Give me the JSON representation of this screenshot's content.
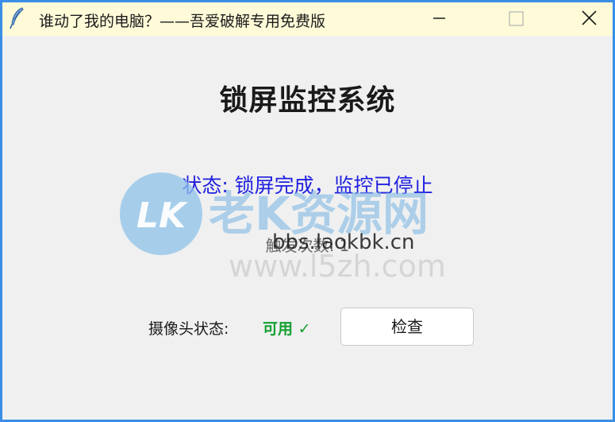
{
  "window": {
    "title": "谁动了我的电脑？——吾爱破解专用免费版"
  },
  "main": {
    "title": "锁屏监控系统",
    "status": "状态: 锁屏完成，监控已停止",
    "trigger": "触发次数: 1",
    "camera_label": "摄像头状态:",
    "camera_value": "可用 ✓",
    "check_button": "检查"
  },
  "watermark": {
    "logo": "LK",
    "brand": "老K资源网",
    "url1": "bbs.laokbk.cn",
    "url2": "www.l5zh.com"
  },
  "colors": {
    "accent_border": "#3a8ee6",
    "titlebar_bg": "#fffbd8",
    "status_text": "#1f1fe0",
    "camera_ok": "#15a030"
  },
  "icons": {
    "app": "feather-icon",
    "minimize": "minimize-icon",
    "maximize": "maximize-icon",
    "close": "close-icon"
  }
}
